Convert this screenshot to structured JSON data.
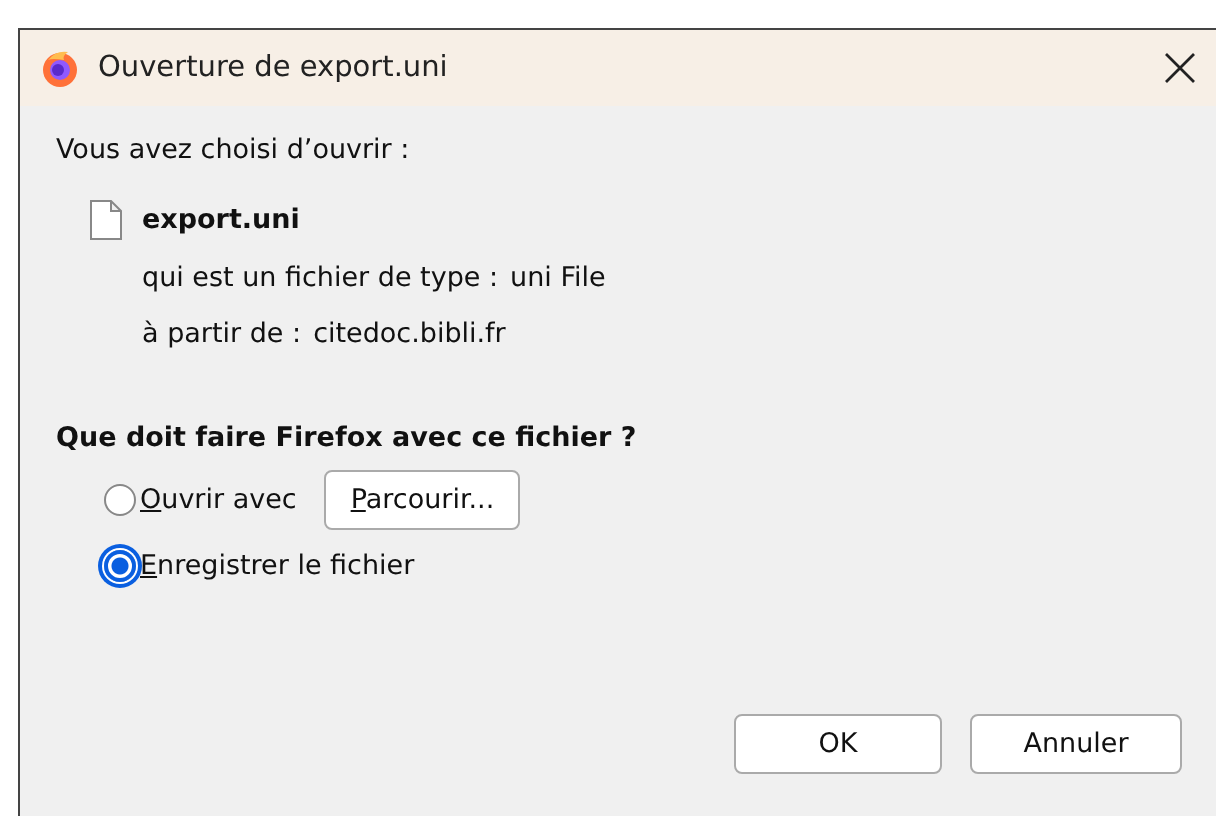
{
  "window": {
    "title": "Ouverture de export.uni"
  },
  "intro": "Vous avez choisi d’ouvrir :",
  "file": {
    "name": "export.uni",
    "details": [
      {
        "label": "qui est un fichier de type :",
        "value": "uni File"
      },
      {
        "label": "à partir de :",
        "value": "citedoc.bibli.fr"
      }
    ]
  },
  "question": "Que doit faire Firefox avec ce fichier ?",
  "options": [
    {
      "label": "Ouvrir avec",
      "selected": false,
      "browse_button": "Parcourir..."
    },
    {
      "label": "Enregistrer le fichier",
      "selected": true
    }
  ],
  "buttons": [
    "OK",
    "Annuler"
  ]
}
